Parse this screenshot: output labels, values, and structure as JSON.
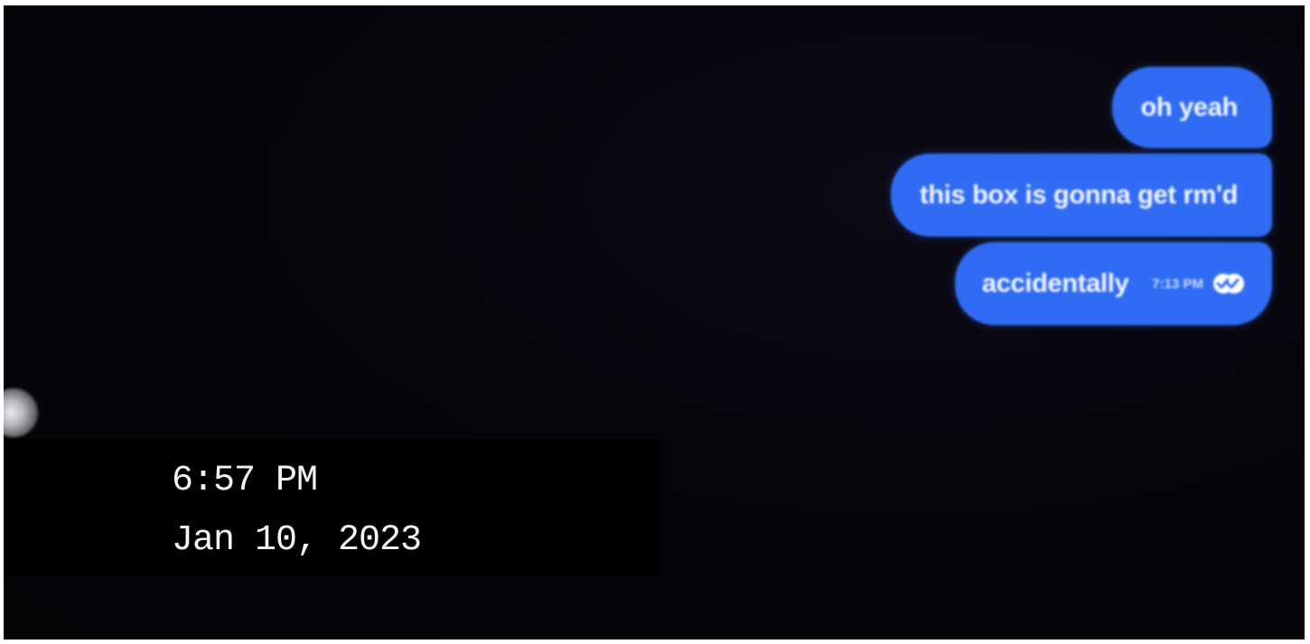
{
  "messages": [
    {
      "text": "oh yeah"
    },
    {
      "text": "this box is gonna get rm'd"
    },
    {
      "text": "accidentally",
      "time": "7:13 PM",
      "status_icon": "read-receipt-icon"
    }
  ],
  "timestamp_overlay": {
    "time": "6:57 PM",
    "date": "Jan 10, 2023"
  },
  "colors": {
    "bubble": "#2f6cf3",
    "background": "#05040a",
    "overlay": "#000000"
  },
  "icons": {
    "scrubber": "playback-scrubber-icon"
  }
}
